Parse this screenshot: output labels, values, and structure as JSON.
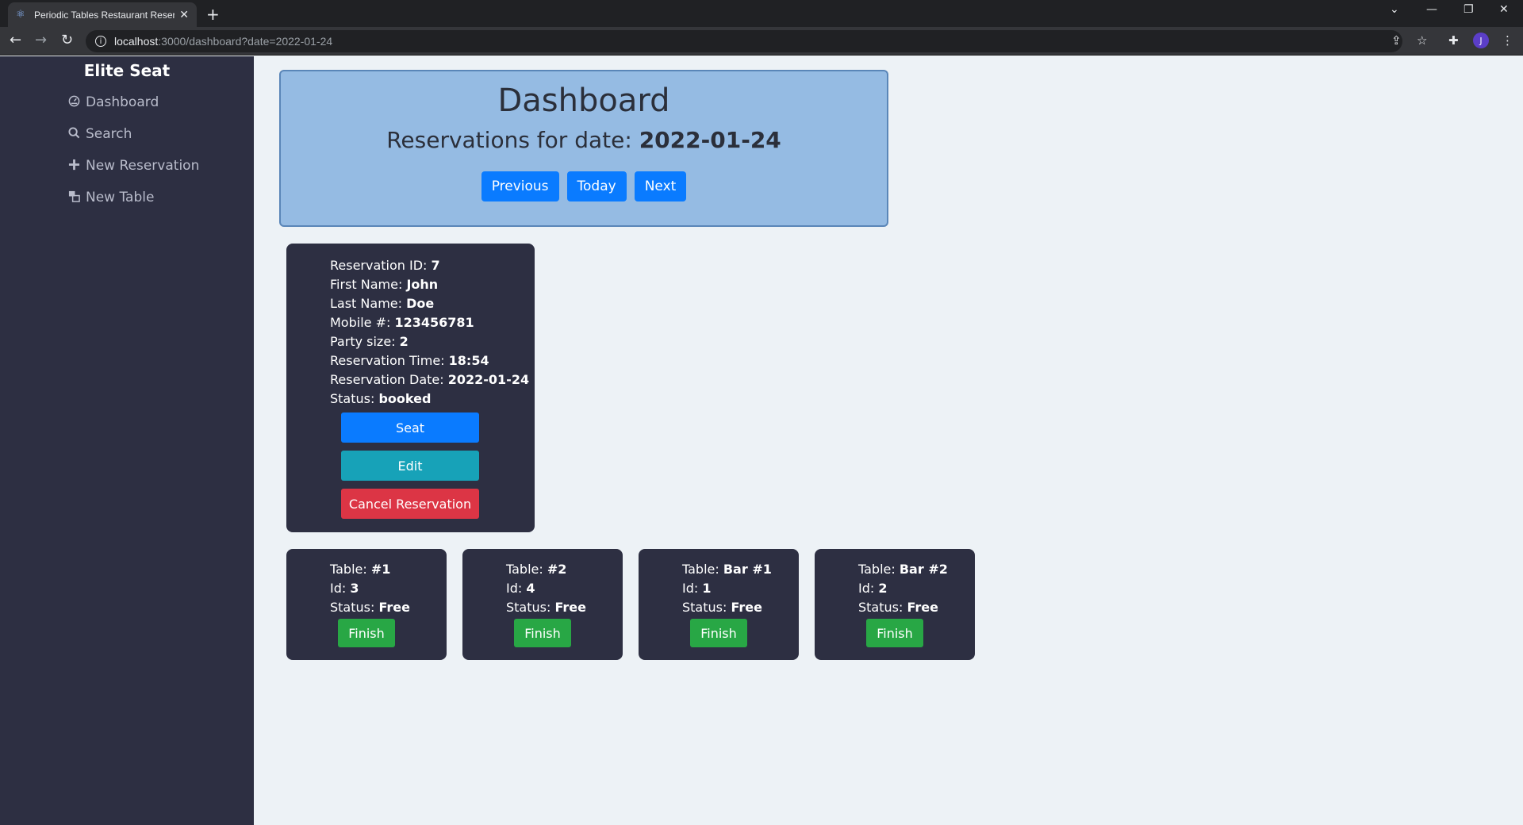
{
  "browser": {
    "tab_title": "Periodic Tables Restaurant Reservations",
    "url_host": "localhost",
    "url_path": ":3000/dashboard?date=2022-01-24",
    "profile_initial": "J"
  },
  "sidebar": {
    "brand": "Elite Seat",
    "items": [
      {
        "label": "Dashboard",
        "icon": "dashboard-icon"
      },
      {
        "label": "Search",
        "icon": "search-icon"
      },
      {
        "label": "New Reservation",
        "icon": "plus-icon"
      },
      {
        "label": "New Table",
        "icon": "table-icon"
      }
    ]
  },
  "header": {
    "title": "Dashboard",
    "subtitle_prefix": "Reservations for date:",
    "date": "2022-01-24",
    "previous_label": "Previous",
    "today_label": "Today",
    "next_label": "Next"
  },
  "reservation": {
    "id_label": "Reservation ID:",
    "id": "7",
    "first_label": "First Name:",
    "first_name": "John",
    "last_label": "Last Name:",
    "last_name": "Doe",
    "mobile_label": "Mobile #:",
    "mobile": "123456781",
    "party_label": "Party size:",
    "party_size": "2",
    "time_label": "Reservation Time:",
    "time": "18:54",
    "date_label": "Reservation Date:",
    "date": "2022-01-24",
    "status_label": "Status:",
    "status": "booked",
    "seat_label": "Seat",
    "edit_label": "Edit",
    "cancel_label": "Cancel Reservation"
  },
  "tables": [
    {
      "name": "#1",
      "id": "3",
      "status": "Free",
      "finish_label": "Finish"
    },
    {
      "name": "#2",
      "id": "4",
      "status": "Free",
      "finish_label": "Finish"
    },
    {
      "name": "Bar #1",
      "id": "1",
      "status": "Free",
      "finish_label": "Finish"
    },
    {
      "name": "Bar #2",
      "id": "2",
      "status": "Free",
      "finish_label": "Finish"
    }
  ],
  "table_labels": {
    "table": "Table:",
    "id": "Id:",
    "status": "Status:"
  },
  "colors": {
    "sidebar": "#2d2f42",
    "header_box": "#95bbe3",
    "primary": "#0a7bff",
    "info": "#17a2b8",
    "danger": "#dc3545",
    "success": "#28a745"
  }
}
